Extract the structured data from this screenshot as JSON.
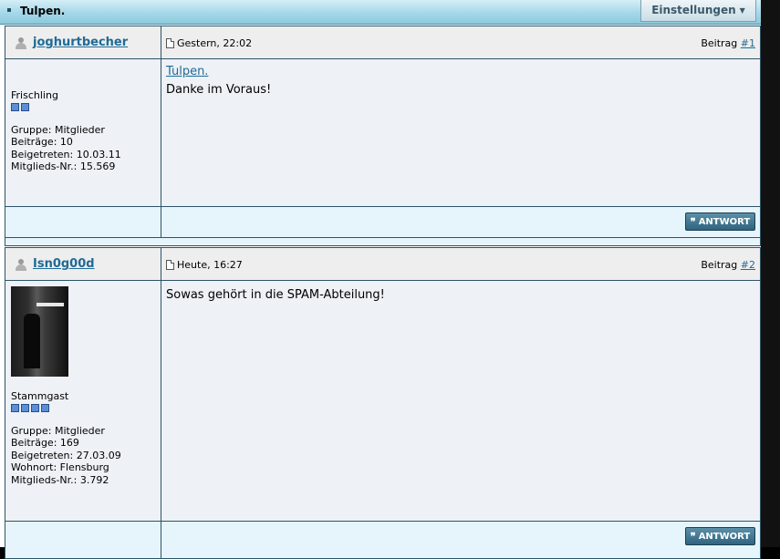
{
  "thread": {
    "title": "Tulpen.",
    "settings_label": "Einstellungen"
  },
  "posts": [
    {
      "username": "joghurtbecher",
      "date": "Gestern, 22:02",
      "post_label": "Beitrag",
      "post_link": "#1",
      "rank": "Frischling",
      "stars": 2,
      "info": [
        "Gruppe: Mitglieder",
        "Beiträge: 10",
        "Beigetreten: 10.03.11",
        "Mitglieds-Nr.: 15.569"
      ],
      "message_title": "Tulpen.",
      "message": "Danke im Voraus!",
      "reply_label": "ANTWORT"
    },
    {
      "username": "Isn0g00d",
      "date": "Heute, 16:27",
      "post_label": "Beitrag",
      "post_link": "#2",
      "rank": "Stammgast",
      "stars": 4,
      "info": [
        "Gruppe: Mitglieder",
        "Beiträge: 169",
        "Beigetreten: 27.03.09",
        "Wohnort: Flensburg",
        "Mitglieds-Nr.: 3.792"
      ],
      "message": "Sowas gehört in die SPAM-Abteilung!",
      "reply_label": "ANTWORT"
    }
  ]
}
